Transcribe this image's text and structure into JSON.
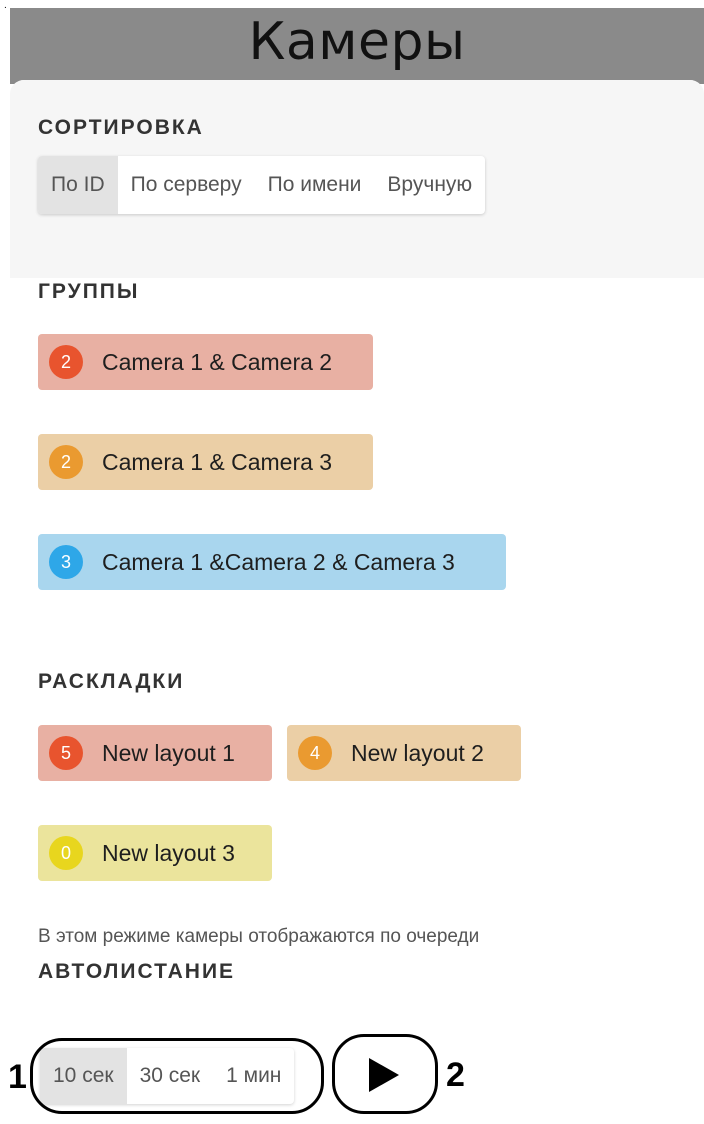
{
  "header": {
    "title": "Камеры"
  },
  "stray_mark": ".",
  "sorting": {
    "title": "СОРТИРОВКА",
    "options": [
      "По ID",
      "По серверу",
      "По имени",
      "Вручную"
    ],
    "selected": "По ID"
  },
  "groups": {
    "title": "ГРУППЫ",
    "items": [
      {
        "count": "2",
        "label": "Camera 1 & Camera 2",
        "color": "#e8b0a3",
        "badge_color": "#e8542e"
      },
      {
        "count": "2",
        "label": "Camera 1 & Camera 3",
        "color": "#ebcfa6",
        "badge_color": "#ea9a30"
      },
      {
        "count": "3",
        "label": "Camera 1 &Camera 2 & Camera 3",
        "color": "#a9d6ee",
        "badge_color": "#2ea7e8"
      }
    ]
  },
  "layouts": {
    "title": "РАСКЛАДКИ",
    "items": [
      {
        "count": "5",
        "label": "New layout 1",
        "color": "#e8b0a3",
        "badge_color": "#e8542e"
      },
      {
        "count": "4",
        "label": "New layout 2",
        "color": "#ebcfa6",
        "badge_color": "#ea9a30"
      },
      {
        "count": "0",
        "label": "New layout 3",
        "color": "#ebe49c",
        "badge_color": "#e8d61e"
      }
    ]
  },
  "autoscroll": {
    "title": "АВТОЛИСТАНИЕ",
    "description": "В этом режиме камеры отображаются по очереди",
    "intervals": [
      "10 сек",
      "30 сек",
      "1 мин"
    ],
    "selected": "10 сек",
    "play_icon": "play-icon"
  },
  "callouts": {
    "one": "1",
    "two": "2"
  }
}
